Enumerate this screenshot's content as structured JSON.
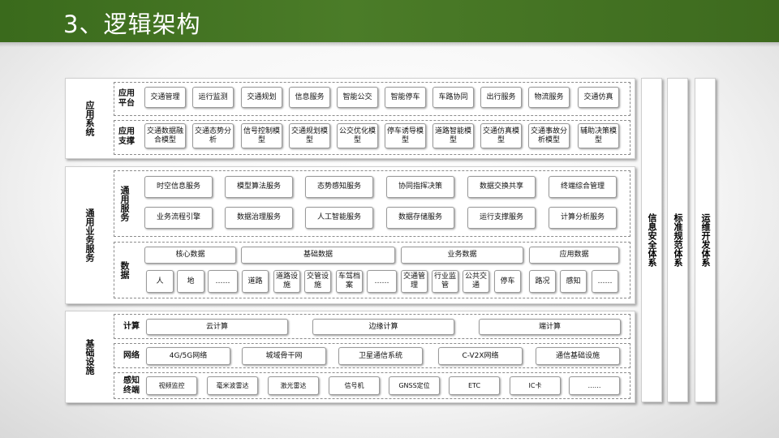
{
  "title": "3、逻辑架构",
  "app_system": {
    "label": "应用系统",
    "platform": {
      "label": "应用平台",
      "items": [
        "交通管理",
        "运行监测",
        "交通规划",
        "信息服务",
        "智能公交",
        "智能停车",
        "车路协同",
        "出行服务",
        "物流服务",
        "交通仿真"
      ]
    },
    "support": {
      "label": "应用支撑",
      "items": [
        "交通数据融合模型",
        "交通态势分析",
        "信号控制模型",
        "交通规划模型",
        "公交优化模型",
        "停车诱导模型",
        "道路智能模型",
        "交通仿真模型",
        "交通事故分析模型",
        "辅助决策模型"
      ]
    }
  },
  "business": {
    "label": "通用业务服务",
    "general": {
      "label": "通用服务",
      "row1": [
        "时空信息服务",
        "模型算法服务",
        "态势感知服务",
        "协同指挥决策",
        "数据交换共享",
        "终端综合管理"
      ],
      "row2": [
        "业务流程引擎",
        "数据治理服务",
        "人工智能服务",
        "数据存储服务",
        "运行支撑服务",
        "计算分析服务"
      ]
    },
    "data": {
      "label": "数据",
      "groups": [
        "核心数据",
        "基础数据",
        "业务数据",
        "应用数据"
      ],
      "core_items": [
        "人",
        "地",
        "……"
      ],
      "base_items": [
        "道路",
        "道路设施",
        "交管设施",
        "车驾档案",
        "……"
      ],
      "biz_items": [
        "交通管理",
        "行业监管",
        "公共交通",
        "停车"
      ],
      "app_items": [
        "路况",
        "感知",
        "……"
      ]
    }
  },
  "infra": {
    "label": "基础设施",
    "compute": {
      "label": "计算",
      "items": [
        "云计算",
        "边缘计算",
        "端计算"
      ]
    },
    "network": {
      "label": "网络",
      "items": [
        "4G/5G网络",
        "城域骨干网",
        "卫星通信系统",
        "C-V2X网络",
        "通信基础设施"
      ]
    },
    "terminal": {
      "label": "感知终端",
      "items": [
        "视频监控",
        "毫米波雷达",
        "激光雷达",
        "信号机",
        "GNSS定位",
        "ETC",
        "IC卡",
        "……"
      ]
    }
  },
  "right_panels": [
    "信息安全体系",
    "标准规范体系",
    "运维开发体系"
  ]
}
